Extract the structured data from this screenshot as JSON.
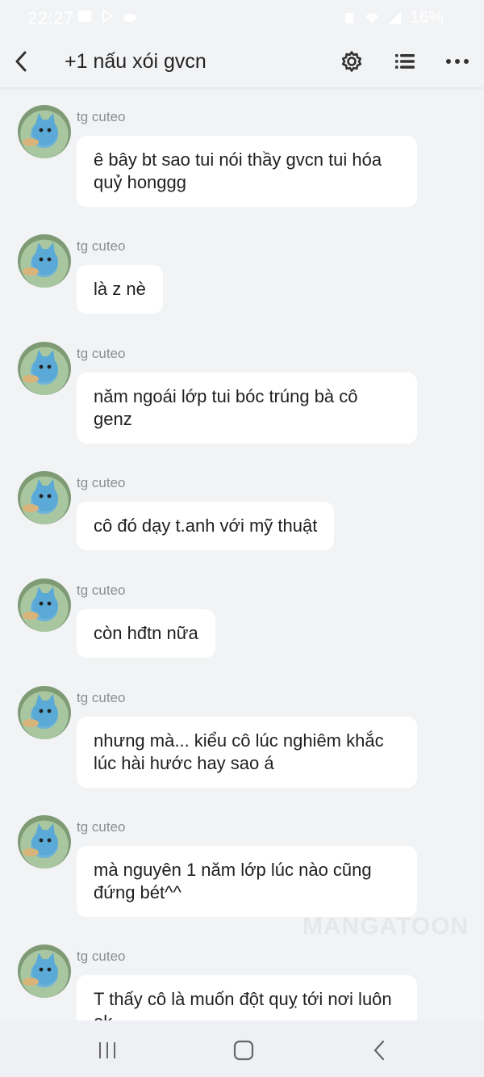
{
  "status_bar": {
    "time": "22:27",
    "battery": "16%"
  },
  "header": {
    "title": "+1 nấu xói gvcn"
  },
  "messages": [
    {
      "sender": "tg cuteo",
      "text": "ê bây bt sao tui nói thầy gvcn tui hóa quỷ honggg"
    },
    {
      "sender": "tg cuteo",
      "text": "là z nè"
    },
    {
      "sender": "tg cuteo",
      "text": "năm ngoái lớp tui bóc trúng bà cô genz"
    },
    {
      "sender": "tg cuteo",
      "text": "cô đó dạy t.anh với mỹ thuật"
    },
    {
      "sender": "tg cuteo",
      "text": "còn hđtn nữa"
    },
    {
      "sender": "tg cuteo",
      "text": "nhưng mà... kiểu cô lúc nghiêm khắc lúc hài hước hay sao á"
    },
    {
      "sender": "tg cuteo",
      "text": "mà nguyên 1 năm lớp lúc nào cũng đứng bét^^"
    },
    {
      "sender": "tg cuteo",
      "text": "T thấy cô là muốn đột quỵ tới nơi luôn ok"
    }
  ],
  "watermark": "MANGATOON",
  "icons": {
    "back": "back-arrow-icon",
    "settings": "gear-icon",
    "list": "list-icon",
    "more": "more-dots-icon"
  }
}
